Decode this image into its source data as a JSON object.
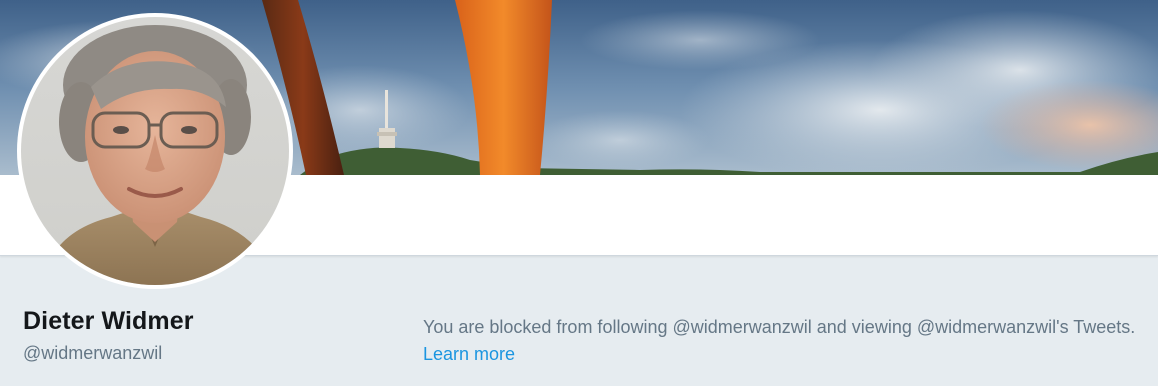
{
  "profile": {
    "display_name": "Dieter Widmer",
    "handle": "@widmerwanzwil"
  },
  "blocked_notice": {
    "message": "You are blocked from following @widmerwanzwil and viewing @widmerwanzwil's Tweets.",
    "learn_more_label": "Learn more"
  },
  "colors": {
    "page_background": "#e6ecf0",
    "name_text": "#14171a",
    "secondary_text": "#657786",
    "link": "#1b95e0"
  }
}
